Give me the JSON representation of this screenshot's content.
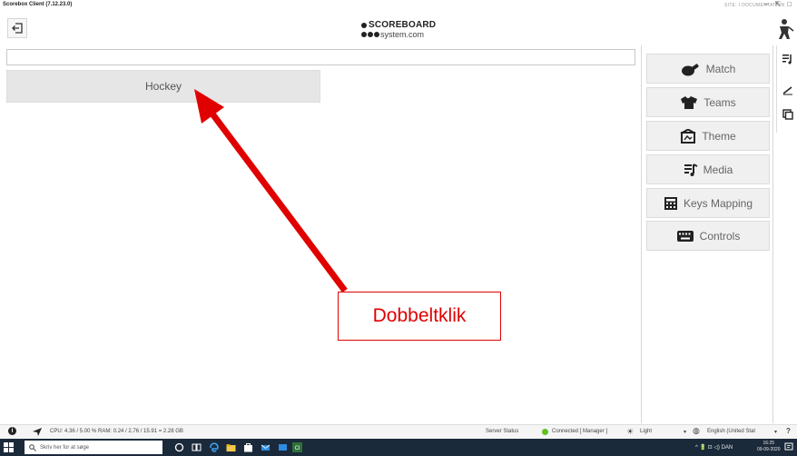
{
  "window": {
    "title": "Scorebox Client (7.12.23.0)",
    "user": "SITE: I DOCUMENTATION",
    "controls": [
      "–",
      "⇱",
      "□"
    ]
  },
  "header": {
    "logo_line1": "SCOREBOARD",
    "logo_line2": "system.com"
  },
  "search": {
    "value": "",
    "placeholder": ""
  },
  "sports": [
    {
      "label": "Hockey"
    }
  ],
  "menu": [
    {
      "label": "Match",
      "icon": "whistle-icon"
    },
    {
      "label": "Teams",
      "icon": "jersey-icon"
    },
    {
      "label": "Theme",
      "icon": "theme-icon"
    },
    {
      "label": "Media",
      "icon": "media-icon"
    },
    {
      "label": "Keys Mapping",
      "icon": "keypad-icon"
    },
    {
      "label": "Controls",
      "icon": "keyboard-icon"
    }
  ],
  "annotation": {
    "text": "Dobbeltklik",
    "color": "#e00000"
  },
  "statusbar": {
    "perf": "CPU: 4.36 / 5.00 %  RAM: 0.24 / 2.76 / 15.91 = 2.28 GB",
    "server_label": "Server Status",
    "connection": "Connected [ Manager ]",
    "brightness": "Light",
    "language": "English (United Stat"
  },
  "taskbar": {
    "search_placeholder": "Skriv her for at søge",
    "tray": "^ 🔋 ⊡ ◁) DAN",
    "time": "16:25",
    "date": "09-09-2020"
  },
  "colors": {
    "accent_red": "#e00000",
    "connected_green": "#5fc020",
    "taskbar": "#1b2a3a"
  }
}
